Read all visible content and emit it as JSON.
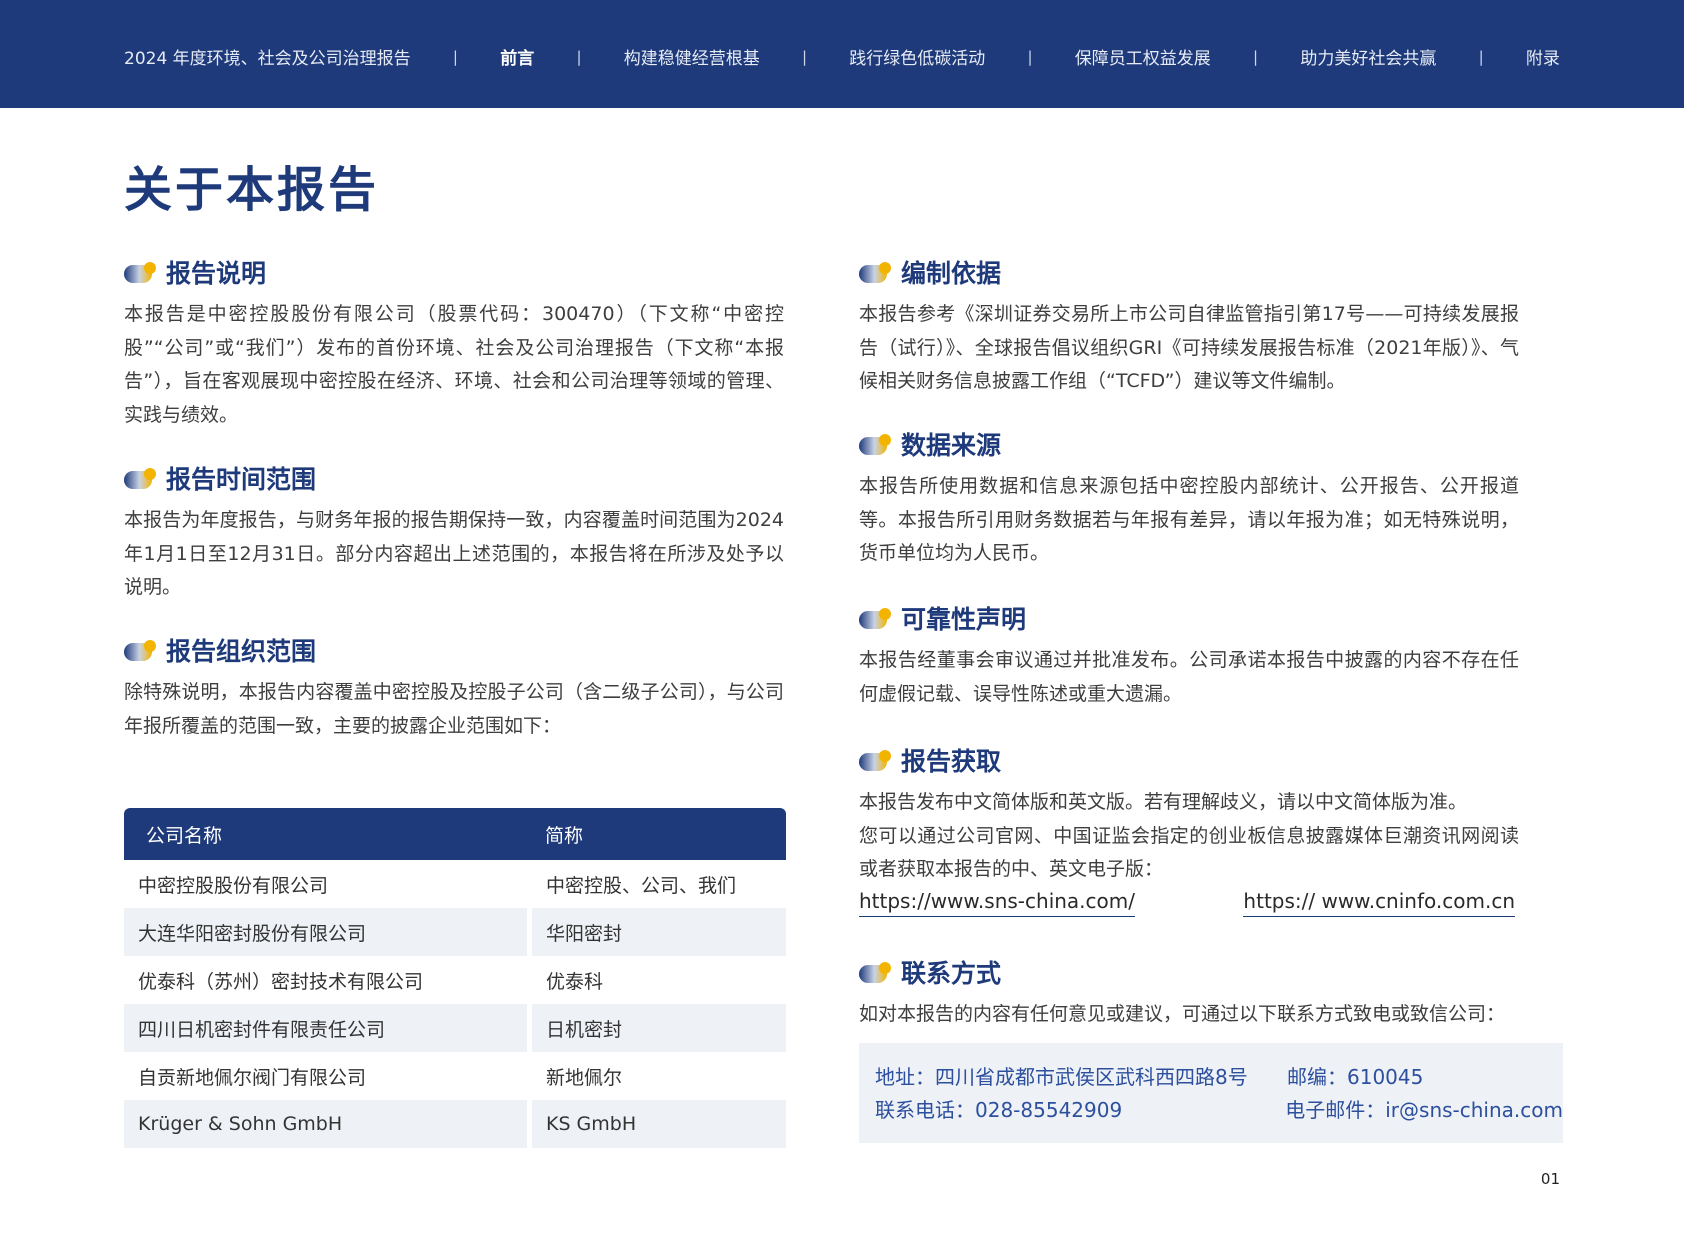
{
  "nav": {
    "items": [
      {
        "label": "2024 年度环境、社会及公司治理报告",
        "active": false
      },
      {
        "label": "前言",
        "active": true
      },
      {
        "label": "构建稳健经营根基",
        "active": false
      },
      {
        "label": "践行绿色低碳活动",
        "active": false
      },
      {
        "label": "保障员工权益发展",
        "active": false
      },
      {
        "label": "助力美好社会共赢",
        "active": false
      },
      {
        "label": "附录",
        "active": false
      }
    ],
    "separator": "|"
  },
  "page_title": "关于本报告",
  "left": {
    "report_desc": {
      "heading": "报告说明",
      "body": "本报告是中密控股股份有限公司（股票代码：300470）（下文称“中密控股”“公司”或“我们”）发布的首份环境、社会及公司治理报告（下文称“本报告”），旨在客观展现中密控股在经济、环境、社会和公司治理等领域的管理、实践与绩效。"
    },
    "time_scope": {
      "heading": "报告时间范围",
      "body": "本报告为年度报告，与财务年报的报告期保持一致，内容覆盖时间范围为2024年1月1日至12月31日。部分内容超出上述范围的，本报告将在所涉及处予以说明。"
    },
    "org_scope": {
      "heading": "报告组织范围",
      "body": "除特殊说明，本报告内容覆盖中密控股及控股子公司（含二级子公司），与公司年报所覆盖的范围一致，主要的披露企业范围如下："
    }
  },
  "table": {
    "headers": [
      "公司名称",
      "简称"
    ],
    "rows": [
      [
        "中密控股股份有限公司",
        "中密控股、公司、我们"
      ],
      [
        "大连华阳密封股份有限公司",
        "华阳密封"
      ],
      [
        "优泰科（苏州）密封技术有限公司",
        "优泰科"
      ],
      [
        "四川日机密封件有限责任公司",
        "日机密封"
      ],
      [
        "自贡新地佩尔阀门有限公司",
        "新地佩尔"
      ],
      [
        "Krüger & Sohn GmbH",
        "KS GmbH"
      ]
    ]
  },
  "right": {
    "basis": {
      "heading": "编制依据",
      "body": "本报告参考《深圳证券交易所上市公司自律监管指引第17号——可持续发展报告（试行）》、全球报告倡议组织GRI《可持续发展报告标准（2021年版）》、气候相关财务信息披露工作组（“TCFD”）建议等文件编制。"
    },
    "data_source": {
      "heading": "数据来源",
      "body": "本报告所使用数据和信息来源包括中密控股内部统计、公开报告、公开报道等。本报告所引用财务数据若与年报有差异，请以年报为准；如无特殊说明，货币单位均为人民币。"
    },
    "reliability": {
      "heading": "可靠性声明",
      "body": "本报告经董事会审议通过并批准发布。公司承诺本报告中披露的内容不存在任何虚假记载、误导性陈述或重大遗漏。"
    },
    "access": {
      "heading": "报告获取",
      "body1": "本报告发布中文简体版和英文版。若有理解歧义，请以中文简体版为准。",
      "body2": "您可以通过公司官网、中国证监会指定的创业板信息披露媒体巨潮资讯网阅读或者获取本报告的中、英文电子版：",
      "link1": "https://www.sns-china.com/",
      "link2": "https:// www.cninfo.com.cn"
    },
    "contact": {
      "heading": "联系方式",
      "body": "如对本报告的内容有任何意见或建议，可通过以下联系方式致电或致信公司：",
      "address": "地址：四川省成都市武侯区武科西四路8号",
      "postcode": "邮编：610045",
      "phone": "联系电话：028-85542909",
      "email": "电子邮件：ir@sns-china.com"
    }
  },
  "page_number": "01",
  "colors": {
    "primary": "#1e3a7a",
    "accent_gold": "#f2b400",
    "row_shade": "#eef1f6",
    "contact_text": "#2c4f9e"
  }
}
